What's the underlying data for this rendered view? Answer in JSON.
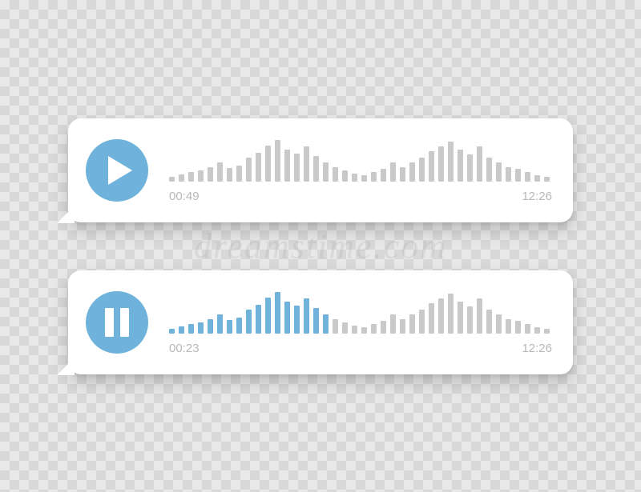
{
  "watermark": "dreamstime.com",
  "colors": {
    "accent": "#6fb3dc",
    "bar_inactive": "#c9c9c9",
    "text_muted": "#b8b8b8"
  },
  "waveform_bars": [
    6,
    9,
    12,
    14,
    18,
    24,
    17,
    20,
    30,
    36,
    45,
    52,
    40,
    35,
    44,
    32,
    24,
    18,
    14,
    10,
    8,
    12,
    16,
    24,
    18,
    24,
    30,
    38,
    44,
    50,
    40,
    34,
    44,
    30,
    24,
    18,
    16,
    12,
    8,
    6
  ],
  "messages": [
    {
      "state": "paused",
      "control_icon": "play-icon",
      "elapsed": "00:49",
      "total": "12:26",
      "played_bars": 0
    },
    {
      "state": "playing",
      "control_icon": "pause-icon",
      "elapsed": "00:23",
      "total": "12:26",
      "played_bars": 17
    }
  ]
}
